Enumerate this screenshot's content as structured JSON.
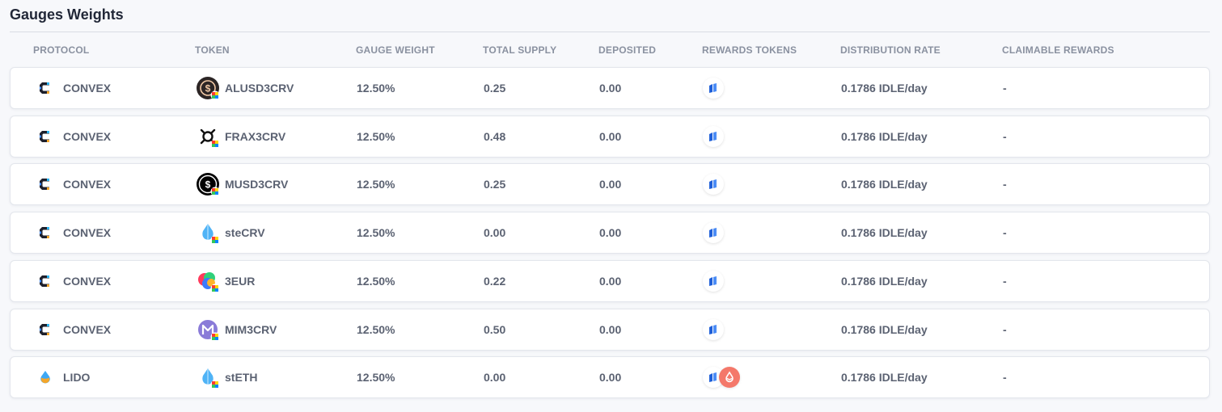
{
  "page": {
    "title": "Gauges Weights"
  },
  "columns": {
    "protocol": "PROTOCOL",
    "token": "TOKEN",
    "gauge_weight": "GAUGE WEIGHT",
    "total_supply": "TOTAL SUPPLY",
    "deposited": "DEPOSITED",
    "rewards_tokens": "REWARDS TOKENS",
    "distribution_rate": "DISTRIBUTION RATE",
    "claimable_rewards": "CLAIMABLE REWARDS"
  },
  "rows": [
    {
      "protocol": "CONVEX",
      "protocol_icon": "convex-icon",
      "token": "ALUSD3CRV",
      "token_icon": "alusd-icon",
      "gauge_weight": "12.50%",
      "total_supply": "0.25",
      "deposited": "0.00",
      "reward_icons": [
        "idle-icon"
      ],
      "distribution_rate": "0.1786 IDLE/day",
      "claimable_rewards": "-"
    },
    {
      "protocol": "CONVEX",
      "protocol_icon": "convex-icon",
      "token": "FRAX3CRV",
      "token_icon": "frax-icon",
      "gauge_weight": "12.50%",
      "total_supply": "0.48",
      "deposited": "0.00",
      "reward_icons": [
        "idle-icon"
      ],
      "distribution_rate": "0.1786 IDLE/day",
      "claimable_rewards": "-"
    },
    {
      "protocol": "CONVEX",
      "protocol_icon": "convex-icon",
      "token": "MUSD3CRV",
      "token_icon": "musd-icon",
      "gauge_weight": "12.50%",
      "total_supply": "0.25",
      "deposited": "0.00",
      "reward_icons": [
        "idle-icon"
      ],
      "distribution_rate": "0.1786 IDLE/day",
      "claimable_rewards": "-"
    },
    {
      "protocol": "CONVEX",
      "protocol_icon": "convex-icon",
      "token": "steCRV",
      "token_icon": "steth-icon",
      "gauge_weight": "12.50%",
      "total_supply": "0.00",
      "deposited": "0.00",
      "reward_icons": [
        "idle-icon"
      ],
      "distribution_rate": "0.1786 IDLE/day",
      "claimable_rewards": "-"
    },
    {
      "protocol": "CONVEX",
      "protocol_icon": "convex-icon",
      "token": "3EUR",
      "token_icon": "3eur-icon",
      "gauge_weight": "12.50%",
      "total_supply": "0.22",
      "deposited": "0.00",
      "reward_icons": [
        "idle-icon"
      ],
      "distribution_rate": "0.1786 IDLE/day",
      "claimable_rewards": "-"
    },
    {
      "protocol": "CONVEX",
      "protocol_icon": "convex-icon",
      "token": "MIM3CRV",
      "token_icon": "mim-icon",
      "gauge_weight": "12.50%",
      "total_supply": "0.50",
      "deposited": "0.00",
      "reward_icons": [
        "idle-icon"
      ],
      "distribution_rate": "0.1786 IDLE/day",
      "claimable_rewards": "-"
    },
    {
      "protocol": "LIDO",
      "protocol_icon": "lido-icon",
      "token": "stETH",
      "token_icon": "steth-icon",
      "gauge_weight": "12.50%",
      "total_supply": "0.00",
      "deposited": "0.00",
      "reward_icons": [
        "idle-icon",
        "ldo-icon"
      ],
      "distribution_rate": "0.1786 IDLE/day",
      "claimable_rewards": "-"
    }
  ],
  "colors": {
    "background": "#f7f8fb",
    "idle_blue": "#1f5fd8",
    "ldo_coral": "#f4786a",
    "lido_blue": "#3ea8f5"
  }
}
